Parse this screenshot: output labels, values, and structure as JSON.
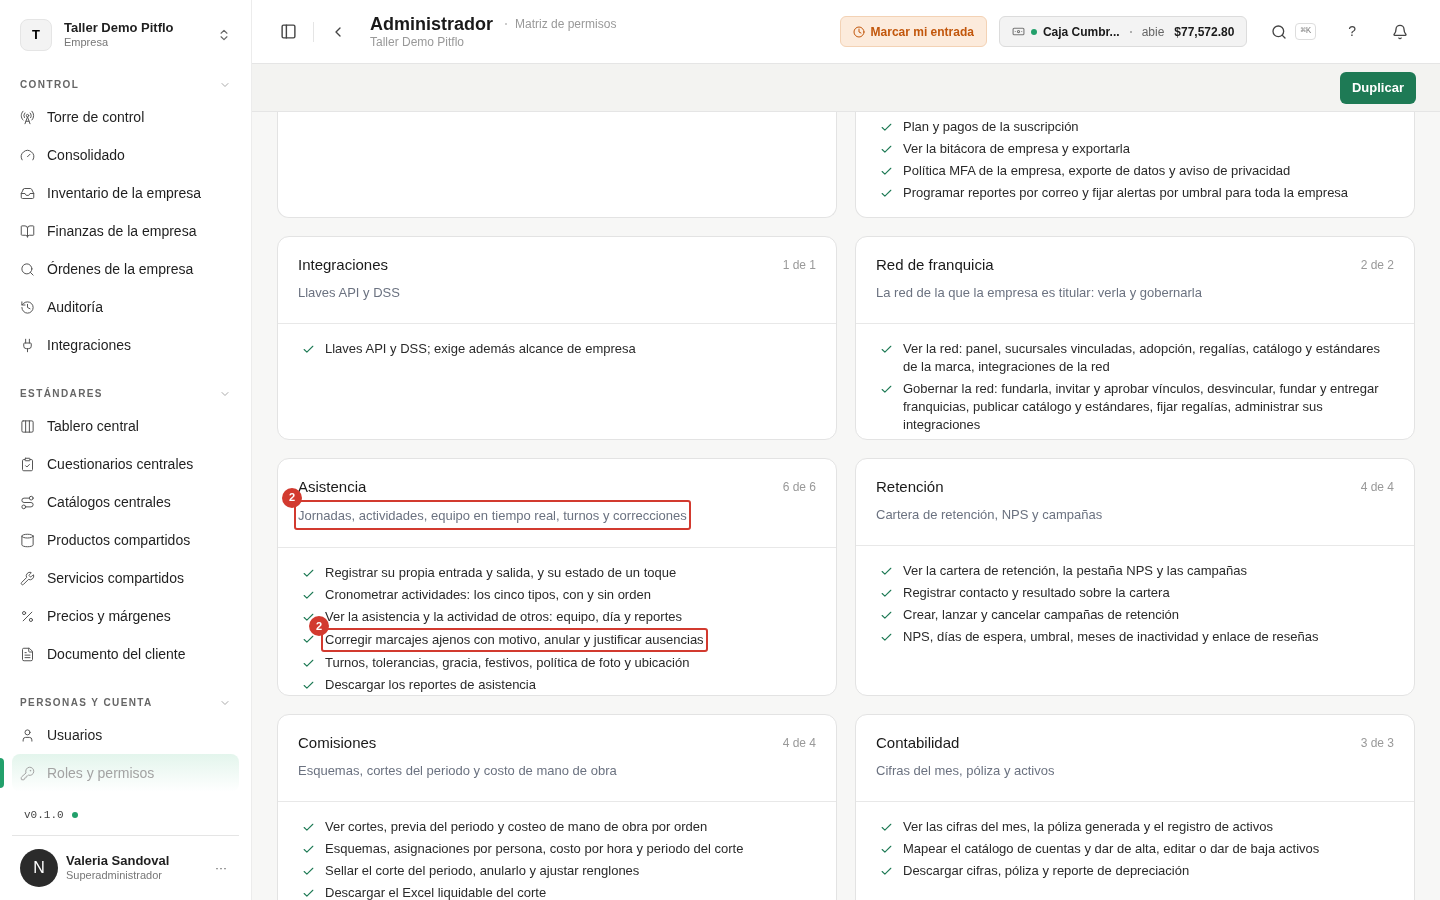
{
  "workspace": {
    "initial": "T",
    "name": "Taller Demo Pitflo",
    "type": "Empresa"
  },
  "sidebar": {
    "sections": [
      {
        "title": "CONTROL",
        "expanded": true,
        "items": [
          {
            "label": "Torre de control",
            "selected": false
          },
          {
            "label": "Consolidado",
            "selected": false
          },
          {
            "label": "Inventario de la empresa",
            "selected": false
          },
          {
            "label": "Finanzas de la empresa",
            "selected": false
          },
          {
            "label": "Órdenes de la empresa",
            "selected": false
          },
          {
            "label": "Auditoría",
            "selected": false
          },
          {
            "label": "Integraciones",
            "selected": false
          }
        ]
      },
      {
        "title": "ESTÁNDARES",
        "expanded": true,
        "items": [
          {
            "label": "Tablero central",
            "selected": false
          },
          {
            "label": "Cuestionarios centrales",
            "selected": false
          },
          {
            "label": "Catálogos centrales",
            "selected": false
          },
          {
            "label": "Productos compartidos",
            "selected": false
          },
          {
            "label": "Servicios compartidos",
            "selected": false
          },
          {
            "label": "Precios y márgenes",
            "selected": false
          },
          {
            "label": "Documento del cliente",
            "selected": false
          }
        ]
      },
      {
        "title": "PERSONAS Y CUENTA",
        "expanded": true,
        "items": [
          {
            "label": "Usuarios",
            "selected": false
          },
          {
            "label": "Roles y permisos",
            "selected": true
          }
        ]
      }
    ],
    "version": "v0.1.0",
    "user": {
      "initial": "N",
      "name": "Valeria Sandoval",
      "role": "Superadministrador",
      "menu": "···"
    }
  },
  "header": {
    "title": "Administrador",
    "breadcrumb": "Matriz de permisos",
    "subtitle": "Taller Demo Pitflo",
    "clock_in": "Marcar mi entrada",
    "register": {
      "name": "Caja Cumbr...",
      "state": "abie",
      "amount": "$77,572.80"
    },
    "shortcut": "⌘K",
    "help": "?"
  },
  "toolbar": {
    "button": "Duplicar"
  },
  "top_cards": [
    {
      "kind": "blank"
    },
    {
      "kind": "list",
      "items": [
        {
          "text": "Plan y pagos de la suscripción"
        },
        {
          "text": "Ver la bitácora de empresa y exportarla"
        },
        {
          "text": "Política MFA de la empresa, exporte de datos y aviso de privacidad"
        },
        {
          "text": "Programar reportes por correo y fijar alertas por umbral para toda la empresa"
        }
      ]
    }
  ],
  "cards": [
    {
      "title": "Integraciones",
      "subtitle": "Llaves API y DSS",
      "count": "1 de 1",
      "items": [
        {
          "text": "Llaves API y DSS; exige además alcance de empresa"
        }
      ]
    },
    {
      "title": "Red de franquicia",
      "subtitle": "La red de la que la empresa es titular: verla y gobernarla",
      "count": "2 de 2",
      "items": [
        {
          "text": "Ver la red: panel, sucursales vinculadas, adopción, regalías, catálogo y estándares de la marca, integraciones de la red"
        },
        {
          "text": "Gobernar la red: fundarla, invitar y aprobar vínculos, desvincular, fundar y entregar franquicias, publicar catálogo y estándares, fijar regalías, administrar sus integraciones"
        }
      ]
    },
    {
      "title": "Asistencia",
      "subtitle": "Jornadas, actividades, equipo en tiempo real, turnos y correcciones",
      "subtitle_annotation": "2",
      "count": "6 de 6",
      "items": [
        {
          "text": "Registrar su propia entrada y salida, y su estado de un toque"
        },
        {
          "text": "Cronometrar actividades: los cinco tipos, con y sin orden"
        },
        {
          "text": "Ver la asistencia y la actividad de otros: equipo, día y reportes"
        },
        {
          "text": "Corregir marcajes ajenos con motivo, anular y justificar ausencias",
          "annotation": "2"
        },
        {
          "text": "Turnos, tolerancias, gracia, festivos, política de foto y ubicación"
        },
        {
          "text": "Descargar los reportes de asistencia"
        }
      ]
    },
    {
      "title": "Retención",
      "subtitle": "Cartera de retención, NPS y campañas",
      "count": "4 de 4",
      "items": [
        {
          "text": "Ver la cartera de retención, la pestaña NPS y las campañas"
        },
        {
          "text": "Registrar contacto y resultado sobre la cartera"
        },
        {
          "text": "Crear, lanzar y cancelar campañas de retención"
        },
        {
          "text": "NPS, días de espera, umbral, meses de inactividad y enlace de reseñas"
        }
      ]
    },
    {
      "title": "Comisiones",
      "subtitle": "Esquemas, cortes del periodo y costo de mano de obra",
      "count": "4 de 4",
      "items": [
        {
          "text": "Ver cortes, previa del periodo y costeo de mano de obra por orden"
        },
        {
          "text": "Esquemas, asignaciones por persona, costo por hora y periodo del corte"
        },
        {
          "text": "Sellar el corte del periodo, anularlo y ajustar renglones"
        },
        {
          "text": "Descargar el Excel liquidable del corte"
        }
      ]
    },
    {
      "title": "Contabilidad",
      "subtitle": "Cifras del mes, póliza y activos",
      "count": "3 de 3",
      "items": [
        {
          "text": "Ver las cifras del mes, la póliza generada y el registro de activos"
        },
        {
          "text": "Mapear el catálogo de cuentas y dar de alta, editar o dar de baja activos"
        },
        {
          "text": "Descargar cifras, póliza y reporte de depreciación"
        }
      ]
    }
  ]
}
